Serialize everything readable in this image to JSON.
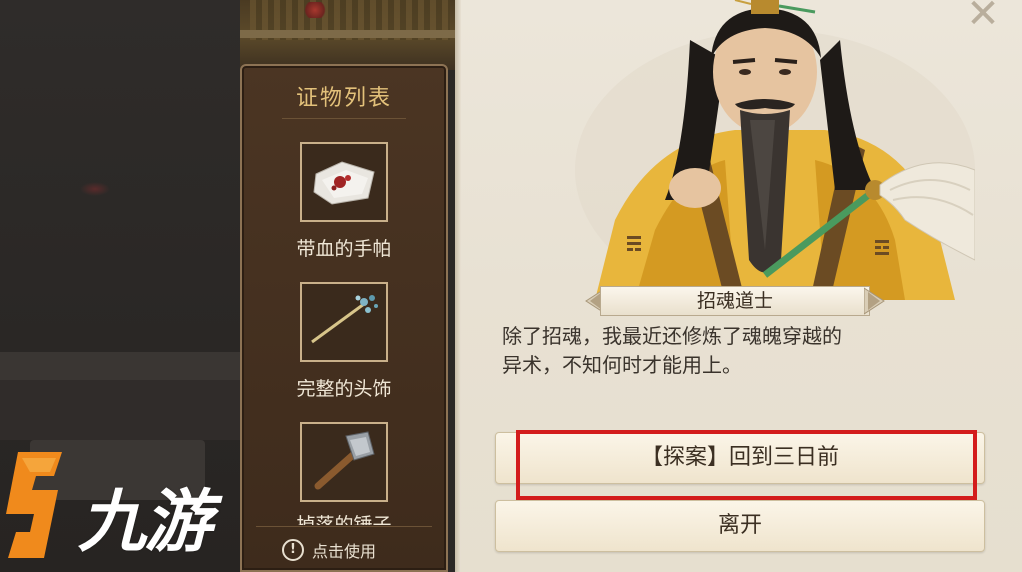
{
  "evidence_panel": {
    "title": "证物列表",
    "items": [
      {
        "label": "带血的手帕",
        "icon": "bloody-handkerchief-icon"
      },
      {
        "label": "完整的头饰",
        "icon": "hairpin-icon"
      },
      {
        "label": "掉落的锤子",
        "icon": "hammer-icon"
      }
    ],
    "use_hint": "点击使用",
    "hint_icon": "!"
  },
  "dialog": {
    "npc_name": "招魂道士",
    "lines": [
      "除了招魂，我最近还修炼了魂魄穿越的",
      "异术，不知何时才能用上。"
    ],
    "options": [
      {
        "label": "【探案】回到三日前",
        "highlighted": true
      },
      {
        "label": "离开",
        "highlighted": false
      }
    ],
    "close_glyph": "✕"
  },
  "watermark": {
    "text": "九游"
  },
  "colors": {
    "highlight": "#d31c1c",
    "title_gold": "#e3c17a",
    "robe_yellow": "#e8b63c"
  }
}
